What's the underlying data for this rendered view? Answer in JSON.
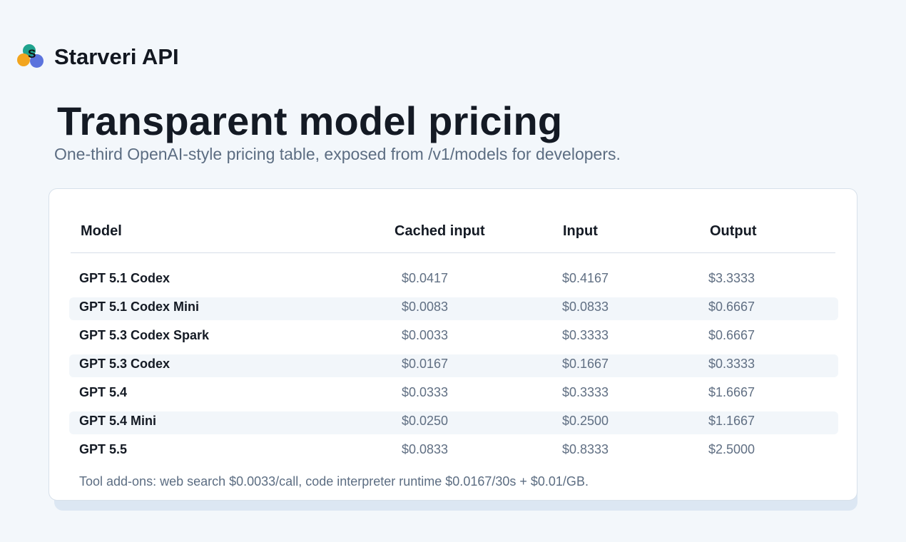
{
  "brand": {
    "logo_letter": "S",
    "name": "Starveri API",
    "logo_colors": [
      "#1fa38e",
      "#f2a51e",
      "#5b73dd"
    ]
  },
  "hero": {
    "title": "Transparent model pricing",
    "subtitle": "One-third OpenAI-style pricing table, exposed from /v1/models for developers."
  },
  "pricing_table": {
    "headers": [
      "Model",
      "Cached input",
      "Input",
      "Output"
    ],
    "rows": [
      {
        "model": "GPT 5.1 Codex",
        "cached_input": "$0.0417",
        "input": "$0.4167",
        "output": "$3.3333"
      },
      {
        "model": "GPT 5.1 Codex Mini",
        "cached_input": "$0.0083",
        "input": "$0.0833",
        "output": "$0.6667"
      },
      {
        "model": "GPT 5.3 Codex Spark",
        "cached_input": "$0.0033",
        "input": "$0.3333",
        "output": "$0.6667"
      },
      {
        "model": "GPT 5.3 Codex",
        "cached_input": "$0.0167",
        "input": "$0.1667",
        "output": "$0.3333"
      },
      {
        "model": "GPT 5.4",
        "cached_input": "$0.0333",
        "input": "$0.3333",
        "output": "$1.6667"
      },
      {
        "model": "GPT 5.4 Mini",
        "cached_input": "$0.0250",
        "input": "$0.2500",
        "output": "$1.1667"
      },
      {
        "model": "GPT 5.5",
        "cached_input": "$0.0833",
        "input": "$0.8333",
        "output": "$2.5000"
      }
    ],
    "footnote": "Tool add-ons: web search $0.0033/call, code interpreter runtime $0.0167/30s + $0.01/GB."
  }
}
